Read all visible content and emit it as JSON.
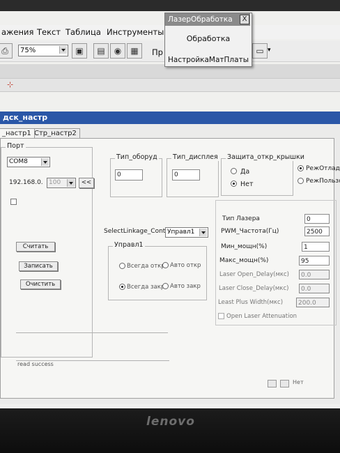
{
  "menu": {
    "items": [
      "ажения",
      "Текст",
      "Таблица",
      "Инструменты",
      "Пр"
    ],
    "zoom": "75%"
  },
  "popup": {
    "title": "ЛазерОбработка",
    "close": "X",
    "buttons": [
      "Обработка",
      "НастройкаМатПлаты"
    ]
  },
  "dialog": {
    "title": "дск_настр",
    "tabs": [
      "_настр1",
      "Стр_настр2"
    ],
    "port": {
      "group": "Порт",
      "com": "COM8",
      "ip_prefix": "192.168.0.",
      "ip_value": "100",
      "ip_button": "<<",
      "buttons": [
        "Считать",
        "Записать",
        "Очистить"
      ]
    },
    "equip_type": {
      "label": "Тип_оборуд",
      "value": "0"
    },
    "display_type": {
      "label": "Тип_дисплея",
      "value": "0"
    },
    "cover": {
      "label": "Защита_откр_крышки",
      "yes": "Да",
      "no": "Нет",
      "mode_debug": "РежОтладк",
      "mode_user": "РежПользов"
    },
    "linkage": {
      "label": "SelectLinkage_Control",
      "value": "Управл1",
      "group": "Управл1",
      "r1": "Всегда откр",
      "r2": "Авто откр",
      "r3": "Всегда закр",
      "r4": "Авто закр"
    },
    "laser": {
      "type_label": "Тип Лазера",
      "type_value": "0",
      "pwm_label": "PWM_Частота(Гц)",
      "pwm_value": "2500",
      "min_label": "Мин_мощн(%)",
      "min_value": "1",
      "max_label": "Макс_мощн(%)",
      "max_value": "95",
      "open_delay_label": "Laser Open_Delay(мкс)",
      "open_delay_value": "0.0",
      "close_delay_label": "Laser Close_Delay(мкс)",
      "close_delay_value": "0.0",
      "least_plus_label": "Least Plus Width(мкс)",
      "least_plus_value": "200.0",
      "attenuation_label": "Open Laser Attenuation"
    },
    "status": "read success",
    "tray_text": "Нет"
  },
  "logo": "lenovo",
  "colors": {
    "titlebar": "#2a57a7",
    "popup_title": "#8a8a8a"
  }
}
